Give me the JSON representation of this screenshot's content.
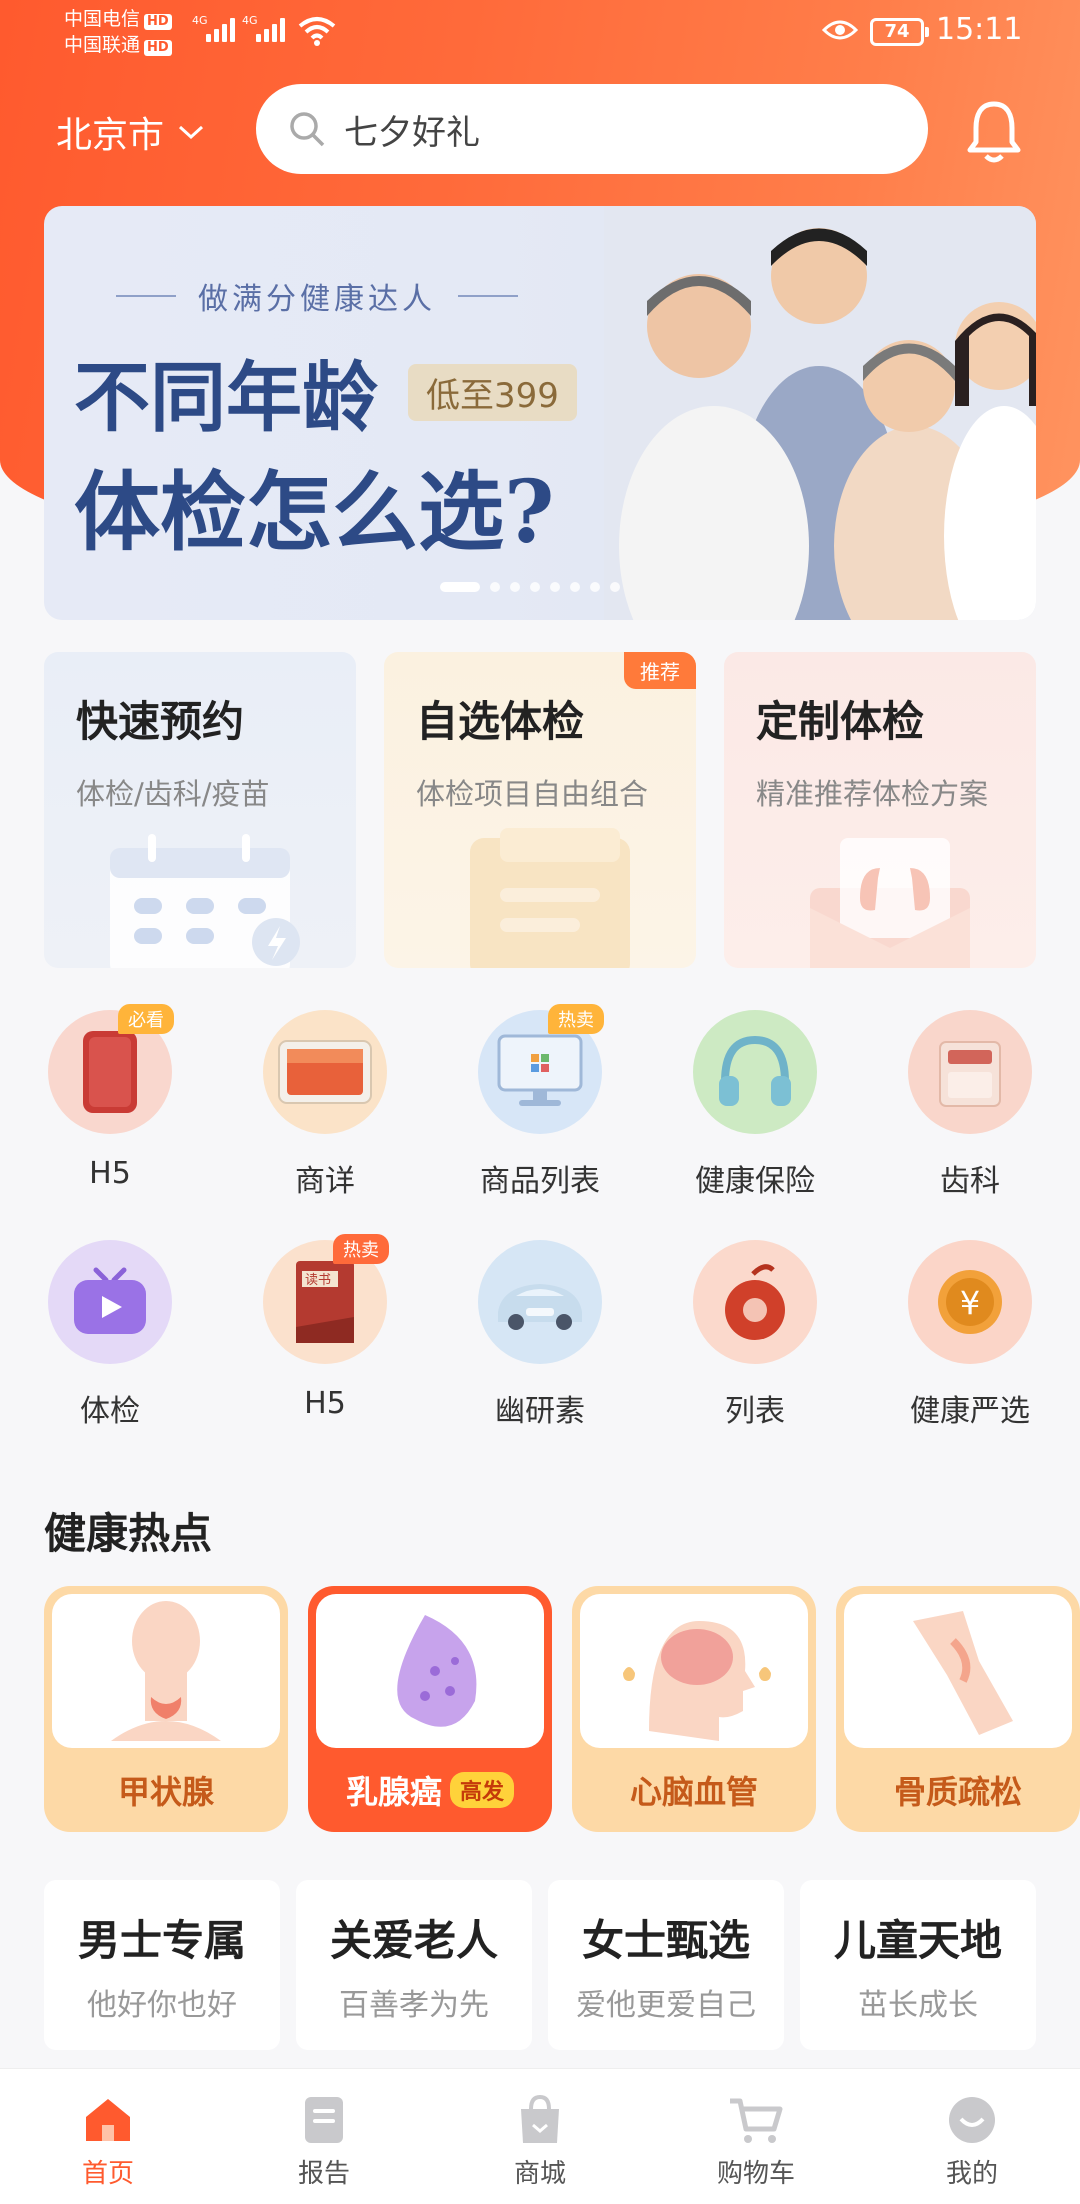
{
  "status_bar": {
    "carrier1": "中国电信",
    "carrier2": "中国联通",
    "hd": "HD",
    "net": "4G",
    "battery": "74",
    "time": "15:11"
  },
  "header": {
    "city": "北京市",
    "search_placeholder": "七夕好礼"
  },
  "banner": {
    "subtitle": "做满分健康达人",
    "title1": "不同年龄",
    "title2": "体检怎么选?",
    "price_tag": "低至399"
  },
  "feature_cards": [
    {
      "title": "快速预约",
      "subtitle": "体检/齿科/疫苗",
      "tag": ""
    },
    {
      "title": "自选体检",
      "subtitle": "体检项目自由组合",
      "tag": "推荐"
    },
    {
      "title": "定制体检",
      "subtitle": "精准推荐体检方案",
      "tag": ""
    }
  ],
  "grid_row1": [
    {
      "label": "H5",
      "badge": "必看",
      "icon": "phone-icon"
    },
    {
      "label": "商详",
      "badge": "",
      "icon": "tablet-icon"
    },
    {
      "label": "商品列表",
      "badge": "热卖",
      "icon": "monitor-icon"
    },
    {
      "label": "健康保险",
      "badge": "",
      "icon": "headphones-icon"
    },
    {
      "label": "齿科",
      "badge": "",
      "icon": "printer-icon"
    }
  ],
  "grid_row2": [
    {
      "label": "体检",
      "badge": "",
      "icon": "tv-play-icon"
    },
    {
      "label": "H5",
      "badge": "热卖",
      "icon": "book-icon"
    },
    {
      "label": "幽研素",
      "badge": "",
      "icon": "car-icon"
    },
    {
      "label": "列表",
      "badge": "",
      "icon": "fruit-icon"
    },
    {
      "label": "健康严选",
      "badge": "",
      "icon": "yen-coin-icon"
    }
  ],
  "hot_section": {
    "title": "健康热点"
  },
  "hot_items": [
    {
      "name": "甲状腺",
      "tag": ""
    },
    {
      "name": "乳腺癌",
      "tag": "高发"
    },
    {
      "name": "心脑血管",
      "tag": ""
    },
    {
      "name": "骨质疏松",
      "tag": ""
    }
  ],
  "categories": [
    {
      "title": "男士专属",
      "subtitle": "他好你也好"
    },
    {
      "title": "关爱老人",
      "subtitle": "百善孝为先"
    },
    {
      "title": "女士甄选",
      "subtitle": "爱他更爱自己"
    },
    {
      "title": "儿童天地",
      "subtitle": "茁长成长"
    }
  ],
  "tabs": [
    {
      "label": "首页",
      "icon": "home-icon"
    },
    {
      "label": "报告",
      "icon": "report-icon"
    },
    {
      "label": "商城",
      "icon": "shop-bag-icon"
    },
    {
      "label": "购物车",
      "icon": "cart-icon"
    },
    {
      "label": "我的",
      "icon": "profile-icon"
    }
  ],
  "colors": {
    "accent": "#ff5a2e",
    "banner_text": "#2d4a86"
  }
}
